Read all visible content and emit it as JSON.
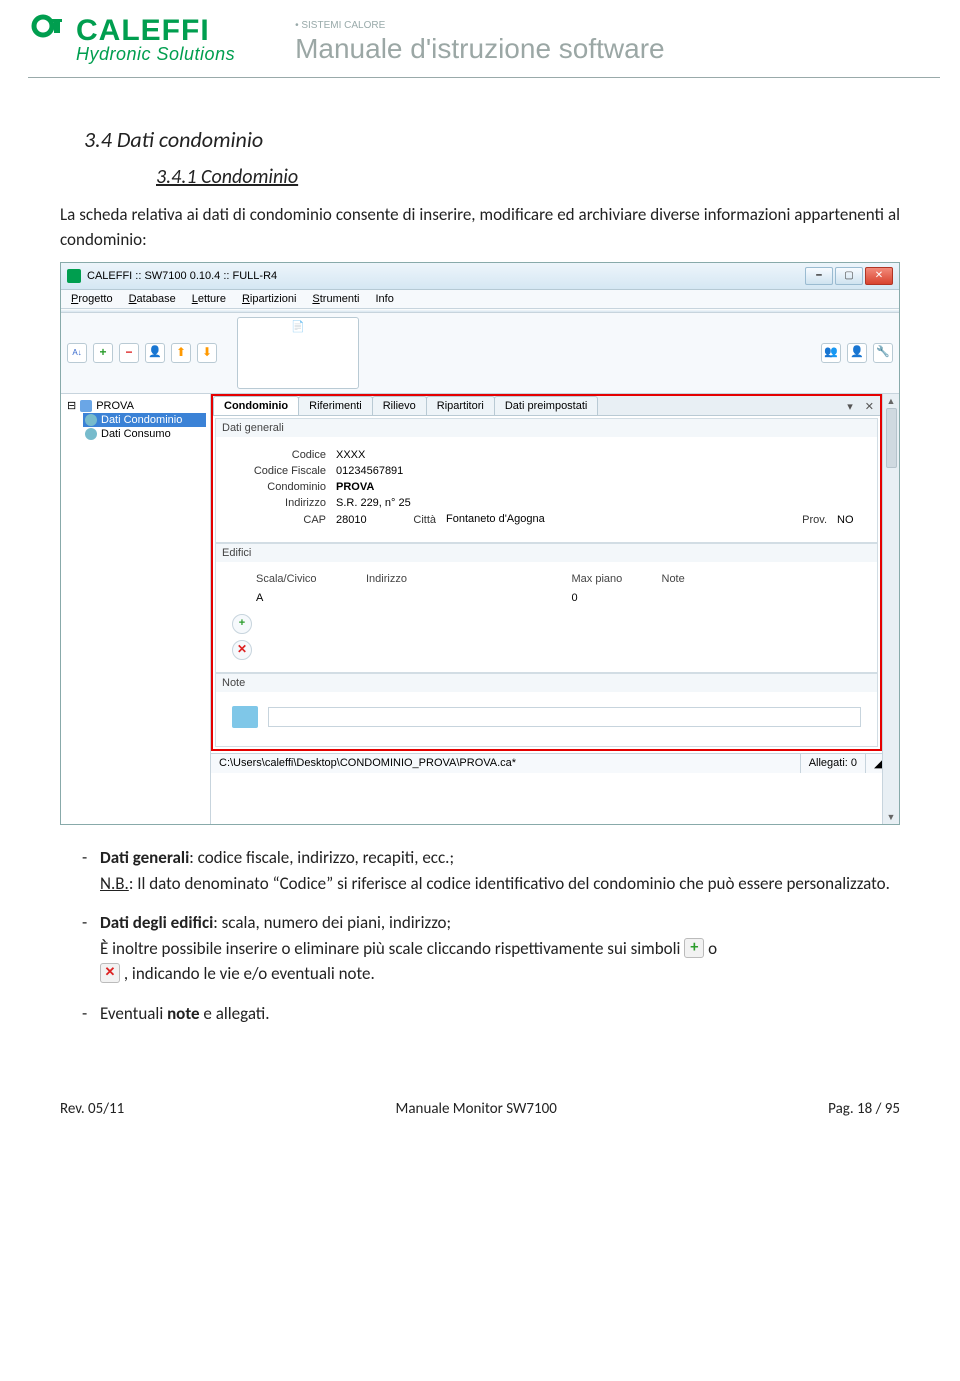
{
  "header": {
    "logo_over": "• SISTEMI CALORE",
    "logo_name": "CALEFFI",
    "logo_sub": "Hydronic Solutions",
    "title": "Manuale d'istruzione software"
  },
  "doc": {
    "h34": "3.4   Dati condominio",
    "h341": "3.4.1  Condominio",
    "intro": "La scheda relativa ai dati di condominio consente di inserire, modificare ed archiviare diverse informazioni appartenenti al condominio:",
    "bullets": {
      "b1_a": "Dati generali",
      "b1_b": ": codice fiscale, indirizzo, recapiti, ecc.;",
      "b1_nb": "N.B.",
      "b1_c": ": Il dato denominato “Codice” si riferisce al codice identificativo del condominio che può essere personalizzato.",
      "b2_a": "Dati degli edifici",
      "b2_b": ": scala, numero dei piani, indirizzo;",
      "b2_c1": "È inoltre possibile inserire o eliminare più scale cliccando rispettivamente sui simboli ",
      "b2_c2": " o ",
      "b2_c3": " , indicando le vie e/o eventuali note.",
      "b3_a": "Eventuali ",
      "b3_b": "note",
      "b3_c": " e allegati."
    }
  },
  "shot": {
    "title": "CALEFFI :: SW7100 0.10.4 :: FULL-R4",
    "menubar": [
      "Progetto",
      "Database",
      "Letture",
      "Ripartizioni",
      "Strumenti",
      "Info"
    ],
    "tree": {
      "root": "PROVA",
      "sel": "Dati Condominio",
      "other": "Dati Consumo"
    },
    "tabs": [
      "Condominio",
      "Riferimenti",
      "Rilievo",
      "Ripartitori",
      "Dati preimpostati"
    ],
    "sections": {
      "generali": "Dati generali",
      "edifici": "Edifici",
      "note": "Note"
    },
    "fields": {
      "codice_l": "Codice",
      "codice_v": "XXXX",
      "cf_l": "Codice Fiscale",
      "cf_v": "01234567891",
      "cond_l": "Condominio",
      "cond_v": "PROVA",
      "ind_l": "Indirizzo",
      "ind_v": "S.R. 229, n° 25",
      "cap_l": "CAP",
      "cap_v": "28010",
      "citta_l": "Città",
      "citta_v": "Fontaneto d'Agogna",
      "prov_l": "Prov.",
      "prov_v": "NO"
    },
    "table": {
      "h1": "Scala/Civico",
      "h2": "Indirizzo",
      "h3": "Max piano",
      "h4": "Note",
      "r1c1": "A",
      "r1c3": "0"
    },
    "status": {
      "path": "C:\\Users\\caleffi\\Desktop\\CONDOMINIO_PROVA\\PROVA.ca*",
      "allegati": "Allegati: 0"
    }
  },
  "footer": {
    "left": "Rev. 05/11",
    "mid": "Manuale Monitor SW7100",
    "right": "Pag. 18 / 95"
  }
}
